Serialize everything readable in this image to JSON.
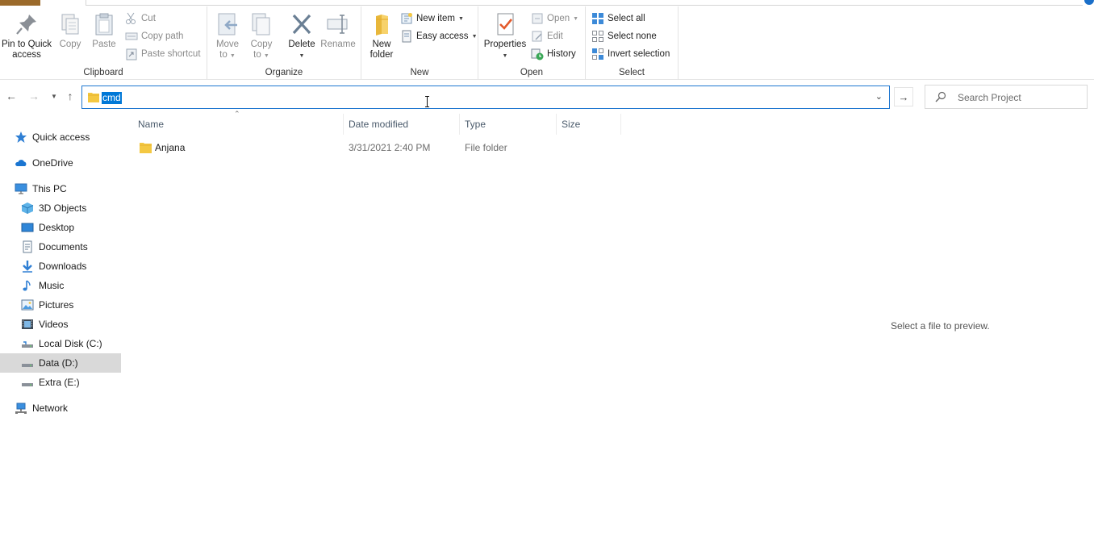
{
  "ribbon": {
    "clipboard": {
      "label": "Clipboard",
      "pin_line1": "Pin to Quick",
      "pin_line2": "access",
      "copy": "Copy",
      "paste": "Paste",
      "cut": "Cut",
      "copy_path": "Copy path",
      "paste_shortcut": "Paste shortcut"
    },
    "organize": {
      "label": "Organize",
      "move_line1": "Move",
      "move_line2": "to",
      "copy_line1": "Copy",
      "copy_line2": "to",
      "delete": "Delete",
      "rename": "Rename"
    },
    "new": {
      "label": "New",
      "folder_line1": "New",
      "folder_line2": "folder",
      "new_item": "New item",
      "easy_access": "Easy access"
    },
    "open": {
      "label": "Open",
      "properties": "Properties",
      "open": "Open",
      "edit": "Edit",
      "history": "History"
    },
    "select": {
      "label": "Select",
      "select_all": "Select all",
      "select_none": "Select none",
      "invert": "Invert selection"
    }
  },
  "address": {
    "value": "cmd",
    "search_placeholder": "Search Project"
  },
  "nav": {
    "items": [
      {
        "label": "Quick access",
        "icon": "star-icon"
      },
      {
        "label": "OneDrive",
        "icon": "cloud-icon"
      },
      {
        "label": "This PC",
        "icon": "computer-icon"
      },
      {
        "label": "3D Objects",
        "icon": "cube-icon"
      },
      {
        "label": "Desktop",
        "icon": "desktop-icon"
      },
      {
        "label": "Documents",
        "icon": "document-icon"
      },
      {
        "label": "Downloads",
        "icon": "download-icon"
      },
      {
        "label": "Music",
        "icon": "music-icon"
      },
      {
        "label": "Pictures",
        "icon": "picture-icon"
      },
      {
        "label": "Videos",
        "icon": "video-icon"
      },
      {
        "label": "Local Disk (C:)",
        "icon": "drive-icon"
      },
      {
        "label": "Data (D:)",
        "icon": "drive-icon"
      },
      {
        "label": "Extra (E:)",
        "icon": "drive-icon"
      },
      {
        "label": "Network",
        "icon": "network-icon"
      }
    ]
  },
  "files": {
    "columns": [
      "Name",
      "Date modified",
      "Type",
      "Size"
    ],
    "rows": [
      {
        "name": "Anjana",
        "date": "3/31/2021 2:40 PM",
        "type": "File folder",
        "size": ""
      }
    ]
  },
  "preview": {
    "message": "Select a file to preview."
  },
  "colors": {
    "accent": "#0078d7",
    "selected_nav": "#d9d9d9",
    "folder": "#f4c842"
  }
}
